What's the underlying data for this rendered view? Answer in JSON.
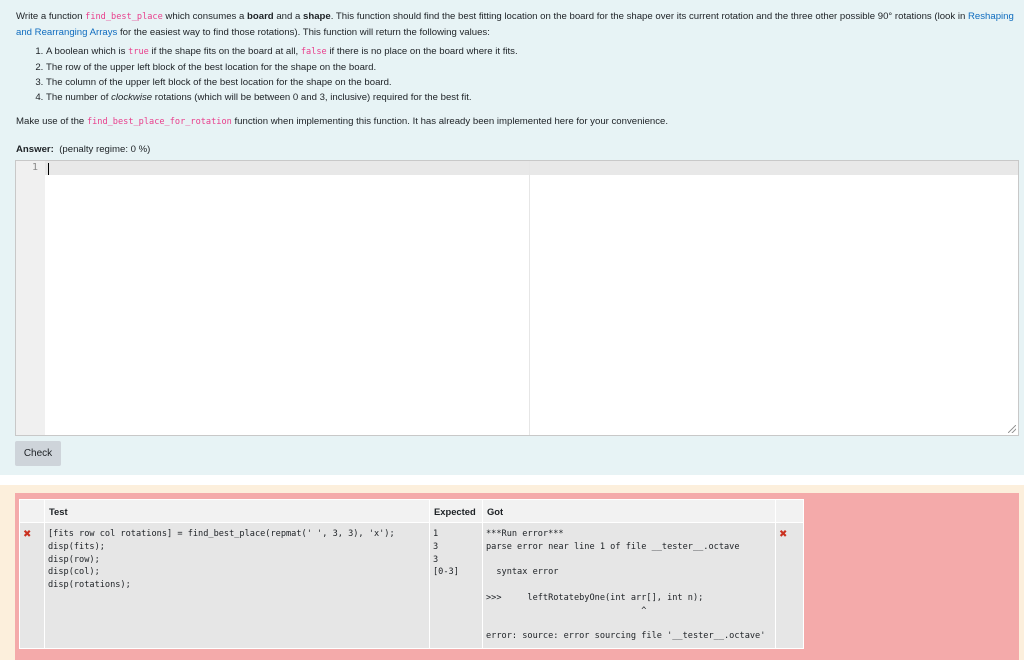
{
  "question": {
    "intro_1": "Write a function ",
    "fn_name": "find_best_place",
    "intro_2": " which consumes a ",
    "board_word": "board",
    "intro_3": " and a ",
    "shape_word": "shape",
    "intro_4": ". This function should find the best fitting location on the board for the shape over its current rotation and the three other possible 90° rotations (look in ",
    "link_text": "Reshaping and Rearranging Arrays",
    "intro_5": " for the easiest way to find those rotations). This function will return the following values:",
    "item1_a": "A boolean which is ",
    "item1_true": "true",
    "item1_b": " if the shape fits on the board at all, ",
    "item1_false": "false",
    "item1_c": " if there is no place on the board where it fits.",
    "item2": "The row of the upper left block of the best location for the shape on the board.",
    "item3": "The column of the upper left block of the best location for the shape on the board.",
    "item4_a": "The number of ",
    "item4_em": "clockwise",
    "item4_b": " rotations (which will be between 0 and 3, inclusive) required for the best fit.",
    "make_use_a": "Make use of the ",
    "helper_fn": "find_best_place_for_rotation",
    "make_use_b": " function when implementing this function. It has already been implemented here for your convenience.",
    "answer_label": "Answer:",
    "penalty": "(penalty regime: 0 %)"
  },
  "editor": {
    "line_number": "1"
  },
  "check_label": "Check",
  "results": {
    "headers": [
      "Test",
      "Expected",
      "Got"
    ],
    "row": {
      "mark": "✖",
      "test": "[fits row col rotations] = find_best_place(repmat(' ', 3, 3), 'x');\ndisp(fits);\ndisp(row);\ndisp(col);\ndisp(rotations);",
      "expected": "1\n3\n3\n[0-3]",
      "got": "***Run error***\nparse error near line 1 of file __tester__.octave\n\n  syntax error\n\n>>>     leftRotatebyOne(int arr[], int n);\n                              ^\n\nerror: source: error sourcing file '__tester__.octave'",
      "mark2": "✖"
    }
  },
  "colors": {
    "question_bg": "#e7f3f5",
    "feedback_bg": "#f4aaaa",
    "link": "#0f6cbf",
    "inline_code": "#e83e8c",
    "fail_mark": "#ca3120"
  }
}
